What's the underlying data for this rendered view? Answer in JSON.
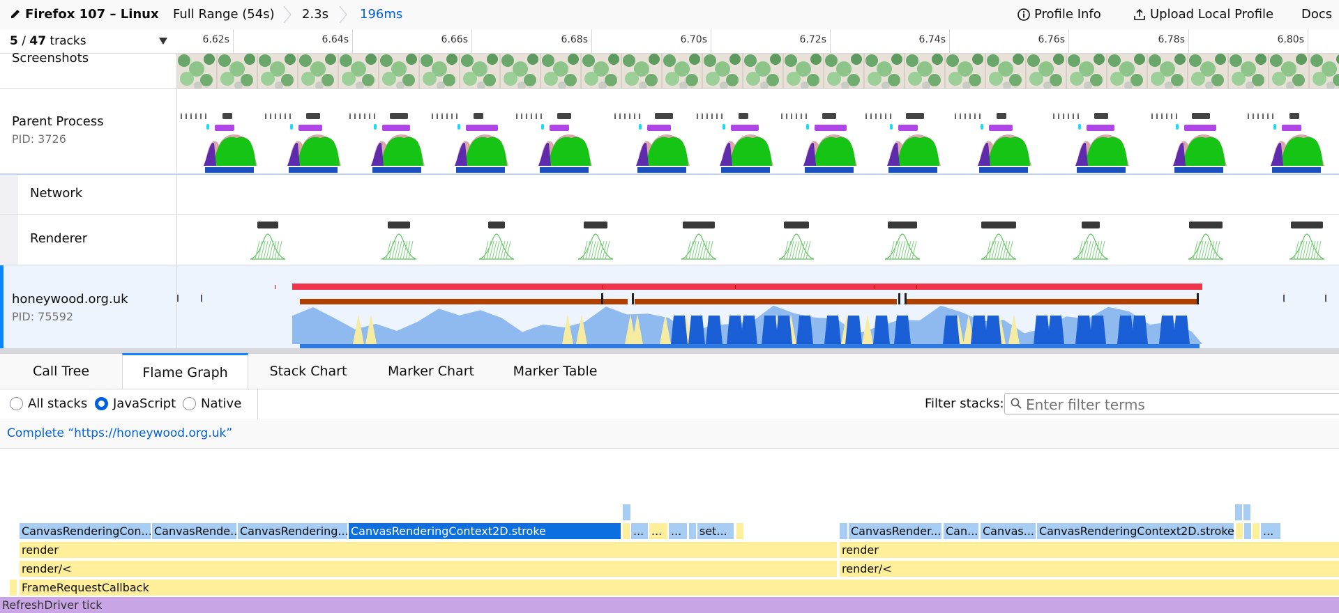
{
  "topbar": {
    "title": "Firefox 107 – Linux",
    "breadcrumbs": [
      "Full Range (54s)",
      "2.3s",
      "196ms"
    ],
    "profile_info": "Profile Info",
    "upload": "Upload Local Profile",
    "docs": "Docs"
  },
  "tracks_header": {
    "visible": "5",
    "total": "47",
    "suffix": "tracks"
  },
  "ruler": {
    "ticks": [
      "6.62s",
      "6.64s",
      "6.66s",
      "6.68s",
      "6.70s",
      "6.72s",
      "6.74s",
      "6.76s",
      "6.78s",
      "6.80s"
    ]
  },
  "tracks": {
    "screenshots": "Screenshots",
    "parent": {
      "name": "Parent Process",
      "pid": "PID: 3726"
    },
    "network": "Network",
    "renderer": "Renderer",
    "content": {
      "name": "honeywood.org.uk",
      "pid": "PID: 75592"
    }
  },
  "tabs": [
    "Call Tree",
    "Flame Graph",
    "Stack Chart",
    "Marker Chart",
    "Marker Table"
  ],
  "settings": {
    "options": [
      "All stacks",
      "JavaScript",
      "Native"
    ],
    "selected": "JavaScript",
    "filter_label": "Filter stacks:",
    "filter_placeholder": "Enter filter terms"
  },
  "breadcrumb": "Complete “https://honeywood.org.uk”",
  "flame": {
    "stroke_left": "CanvasRenderingContext2D.stroke",
    "stroke_right": "CanvasRenderingContext2D.stroke",
    "c1": "CanvasRenderingCon...",
    "c2": "CanvasRende...",
    "c3": "CanvasRendering...",
    "c4": "...",
    "c5": "...",
    "c6": "...",
    "c7": "set...",
    "c8": "CanvasRender...",
    "c9": "Can...",
    "c10": "Canvas...",
    "c11": "...",
    "render_l": "render",
    "render_r": "render",
    "renderlt_l": "render/<",
    "renderlt_r": "render/<",
    "frcb": "FrameRequestCallback",
    "refresh": "RefreshDriver tick"
  },
  "colors": {
    "accent": "#0a84ff",
    "js_yellow": "#ffef9b",
    "js_blue": "#a8cdf5",
    "selected_blue": "#0b6fe0",
    "red_marker": "#f0344c",
    "brown_marker": "#b04000"
  }
}
